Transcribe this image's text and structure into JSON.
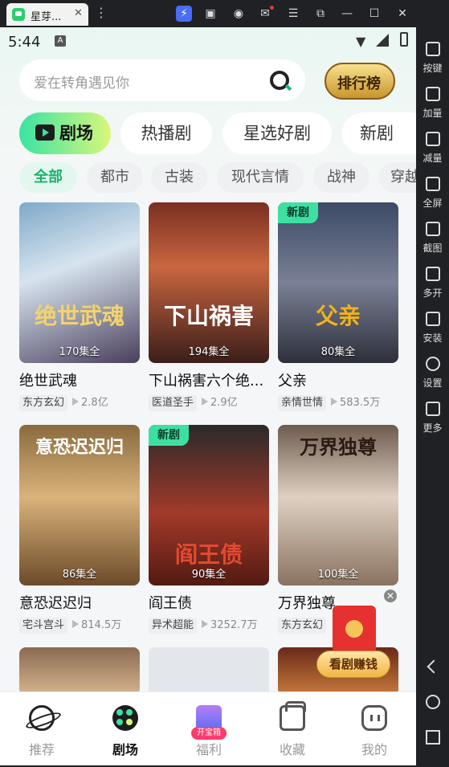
{
  "window": {
    "tab_title": "星芽...",
    "tab_close": "✕",
    "menu_dots": "⋮",
    "toolbar_icons": [
      "bolt-icon",
      "gamepad-icon",
      "user-circle-icon",
      "mail-icon",
      "hamburger-icon",
      "resize-icon",
      "minimize-icon",
      "maximize-icon",
      "close-icon"
    ]
  },
  "status": {
    "time": "5:44",
    "a_badge": "A"
  },
  "search": {
    "placeholder": "爱在转角遇见你",
    "rank_label": "排行榜"
  },
  "category_tabs": [
    {
      "label": "剧场",
      "active": true
    },
    {
      "label": "热播剧",
      "active": false
    },
    {
      "label": "星选好剧",
      "active": false
    },
    {
      "label": "新剧",
      "active": false
    }
  ],
  "filter_chips": [
    {
      "label": "全部",
      "active": true
    },
    {
      "label": "都市",
      "active": false
    },
    {
      "label": "古装",
      "active": false
    },
    {
      "label": "现代言情",
      "active": false
    },
    {
      "label": "战神",
      "active": false
    },
    {
      "label": "穿越",
      "active": false
    }
  ],
  "dramas": [
    {
      "name": "绝世武魂",
      "episodes": "170集全",
      "tag": "东方玄幻",
      "views": "2.8亿",
      "new": false,
      "poster_text": "绝世武魂",
      "accent": "#f3d36b"
    },
    {
      "name": "下山祸害六个绝...",
      "episodes": "194集全",
      "tag": "医道圣手",
      "views": "2.9亿",
      "new": false,
      "poster_text": "下山祸害",
      "accent": "#ffffff"
    },
    {
      "name": "父亲",
      "episodes": "80集全",
      "tag": "亲情世情",
      "views": "583.5万",
      "new": true,
      "poster_text": "父亲",
      "accent": "#f2b319"
    },
    {
      "name": "意恐迟迟归",
      "episodes": "86集全",
      "tag": "宅斗宫斗",
      "views": "814.5万",
      "new": false,
      "poster_text": "意恐迟迟归",
      "accent": "#ffffff"
    },
    {
      "name": "阎王债",
      "episodes": "90集全",
      "tag": "异术超能",
      "views": "3252.7万",
      "new": true,
      "poster_text": "阎王债",
      "accent": "#e34a2f"
    },
    {
      "name": "万界独尊",
      "episodes": "100集全",
      "tag": "东方玄幻",
      "views": "",
      "new": false,
      "poster_text": "万界独尊",
      "accent": "#2b1a12"
    }
  ],
  "badges": {
    "new": "新剧"
  },
  "floating": {
    "close": "✕",
    "earn_label": "看剧赚钱"
  },
  "bottom_nav": [
    {
      "label": "推荐",
      "active": false
    },
    {
      "label": "剧场",
      "active": true
    },
    {
      "label": "福利",
      "active": false,
      "badge": "开宝箱"
    },
    {
      "label": "收藏",
      "active": false
    },
    {
      "label": "我的",
      "active": false
    }
  ],
  "sidebar": [
    {
      "label": "按键"
    },
    {
      "label": "加量"
    },
    {
      "label": "减量"
    },
    {
      "label": "全屏"
    },
    {
      "label": "截图"
    },
    {
      "label": "多开"
    },
    {
      "label": "安装"
    },
    {
      "label": "设置"
    },
    {
      "label": "更多"
    }
  ]
}
